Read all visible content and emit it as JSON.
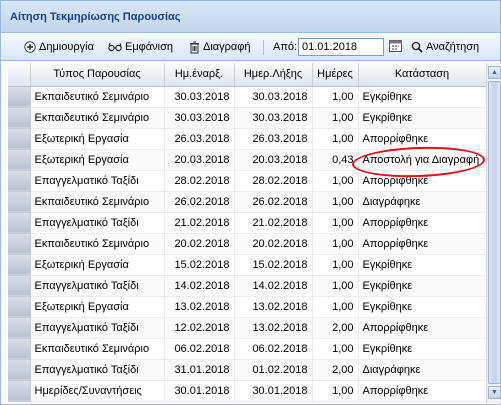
{
  "panel": {
    "title": "Αίτηση Τεκμηρίωσης Παρουσίας"
  },
  "toolbar": {
    "create_label": "Δημιουργία",
    "view_label": "Εμφάνιση",
    "delete_label": "Διαγραφή",
    "from_label": "Από:",
    "from_date": "01.01.2018",
    "search_label": "Αναζήτηση"
  },
  "grid": {
    "columns": [
      "Τύπος Παρουσίας",
      "Ημ.έναρξ.",
      "Ημερ.Λήξης",
      "Ημέρες",
      "Κατάσταση"
    ],
    "rows": [
      [
        "Εκπαιδευτικό Σεμινάριο",
        "30.03.2018",
        "30.03.2018",
        "1,00",
        "Εγκρίθηκε"
      ],
      [
        "Εκπαιδευτικό Σεμινάριο",
        "30.03.2018",
        "30.03.2018",
        "1,00",
        "Εγκρίθηκε"
      ],
      [
        "Εξωτερική Εργασία",
        "26.03.2018",
        "26.03.2018",
        "1,00",
        "Απορρίφθηκε"
      ],
      [
        "Εξωτερική Εργασία",
        "20.03.2018",
        "20.03.2018",
        "0,43",
        "Αποστολή για Διαγραφή"
      ],
      [
        "Επαγγελματικό Ταξίδι",
        "28.02.2018",
        "28.02.2018",
        "1,00",
        "Απορρίφθηκε"
      ],
      [
        "Εκπαιδευτικό Σεμινάριο",
        "26.02.2018",
        "26.02.2018",
        "1,00",
        "Διαγράφηκε"
      ],
      [
        "Επαγγελματικό Ταξίδι",
        "21.02.2018",
        "21.02.2018",
        "1,00",
        "Απορρίφθηκε"
      ],
      [
        "Εκπαιδευτικό Σεμινάριο",
        "20.02.2018",
        "20.02.2018",
        "1,00",
        "Απορρίφθηκε"
      ],
      [
        "Εξωτερική Εργασία",
        "15.02.2018",
        "15.02.2018",
        "1,00",
        "Εγκρίθηκε"
      ],
      [
        "Επαγγελματικό Ταξίδι",
        "14.02.2018",
        "14.02.2018",
        "1,00",
        "Εγκρίθηκε"
      ],
      [
        "Εξωτερική Εργασία",
        "13.02.2018",
        "13.02.2018",
        "1,00",
        "Εγκρίθηκε"
      ],
      [
        "Επαγγελματικό Ταξίδι",
        "12.02.2018",
        "13.02.2018",
        "2,00",
        "Απορρίφθηκε"
      ],
      [
        "Εκπαιδευτικό Σεμινάριο",
        "06.02.2018",
        "06.02.2018",
        "1,00",
        "Εγκρίθηκε"
      ],
      [
        "Επαγγελματικό Ταξίδι",
        "31.01.2018",
        "01.02.2018",
        "2,00",
        "Διαγράφηκε"
      ],
      [
        "Ημερίδες/Συναντήσεις",
        "30.01.2018",
        "30.01.2018",
        "1,00",
        "Απορρίφθηκε"
      ]
    ]
  },
  "colors": {
    "highlight": "#e0121b",
    "header_text": "#15428b"
  }
}
